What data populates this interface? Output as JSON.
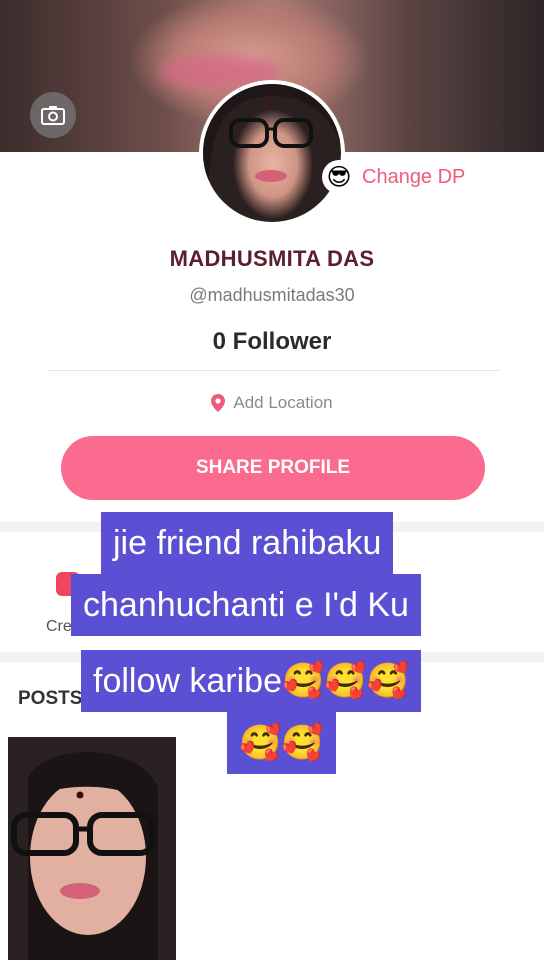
{
  "profile": {
    "name": "MADHUSMITA DAS",
    "handle": "@madhusmitadas30",
    "followers": "0 Follower",
    "location": "Add Location",
    "change_dp": "Change DP",
    "change_dp_emoji": "😎",
    "share_button": "SHARE PROFILE"
  },
  "tabs": {
    "create_label": "Cre",
    "posts_label": "POSTS"
  },
  "overlay_caption": {
    "lines": [
      "jie friend rahibaku",
      "chanhuchanti e I'd Ku",
      "follow karibe🥰🥰🥰",
      "🥰🥰"
    ]
  },
  "icons": {
    "camera": "camera-icon",
    "location": "location-pin-icon"
  },
  "colors": {
    "accent": "#fb6a8f",
    "name": "#5c1f2c",
    "overlay_bg": "#5b4fd3"
  }
}
